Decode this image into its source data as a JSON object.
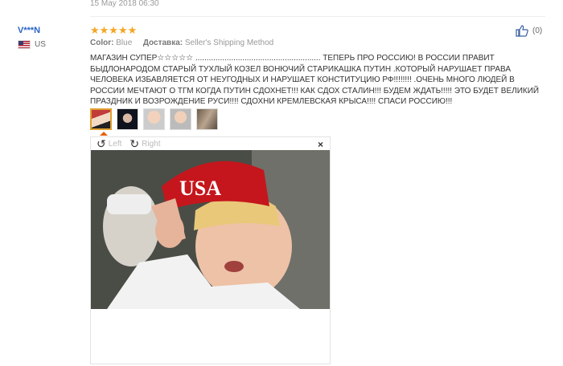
{
  "prev_review": {
    "date": "15 May 2018 06:30"
  },
  "review": {
    "user": "V***N",
    "country": "US",
    "stars": "★★★★★",
    "rating": 5,
    "color_label": "Color:",
    "color_value": "Blue",
    "delivery_label": "Доставка:",
    "delivery_value": "Seller's Shipping Method",
    "text": "МАГАЗИН СУПЕР☆☆☆☆☆ ........................................................ ТЕПЕРЬ ПРО РОССИЮ! В РОССИИ ПРАВИТ БЫДЛОНАРОДОМ СТАРЫЙ ТУХЛЫЙ КОЗЕЛ ВОНЮЧИЙ СТАРИКАШКА ПУТИН .КОТОРЫЙ НАРУШАЕТ ПРАВА ЧЕЛОВЕКА ИЗБАВЛЯЕТСЯ ОТ НЕУГОДНЫХ И НАРУШАЕТ КОНСТИТУЦИЮ РФ!!!!!!!! .ОЧЕНЬ МНОГО ЛЮДЕЙ В РОССИИ МЕЧТАЮТ О ТГМ КОГДА ПУТИН СДОХНЕТ!!! КАК СДОХ СТАЛИН!!! БУДЕМ ЖДАТЬ!!!!! ЭТО БУДЕТ ВЕЛИКИЙ ПРАЗДНИК И ВОЗРОЖДЕНИЕ РУСИ!!!! СДОХНИ КРЕМЛЕВСКАЯ КРЫСА!!!! СПАСИ РОССИЮ!!!",
    "likes": "(0)"
  },
  "viewer": {
    "rotate_left": "Left",
    "rotate_right": "Right",
    "close": "×",
    "cap_text": "USA"
  },
  "colors": {
    "username": "#2a64c5",
    "stars": "#f5a623",
    "thumb_active_border": "#e0a030",
    "notch": "#e8600a"
  }
}
